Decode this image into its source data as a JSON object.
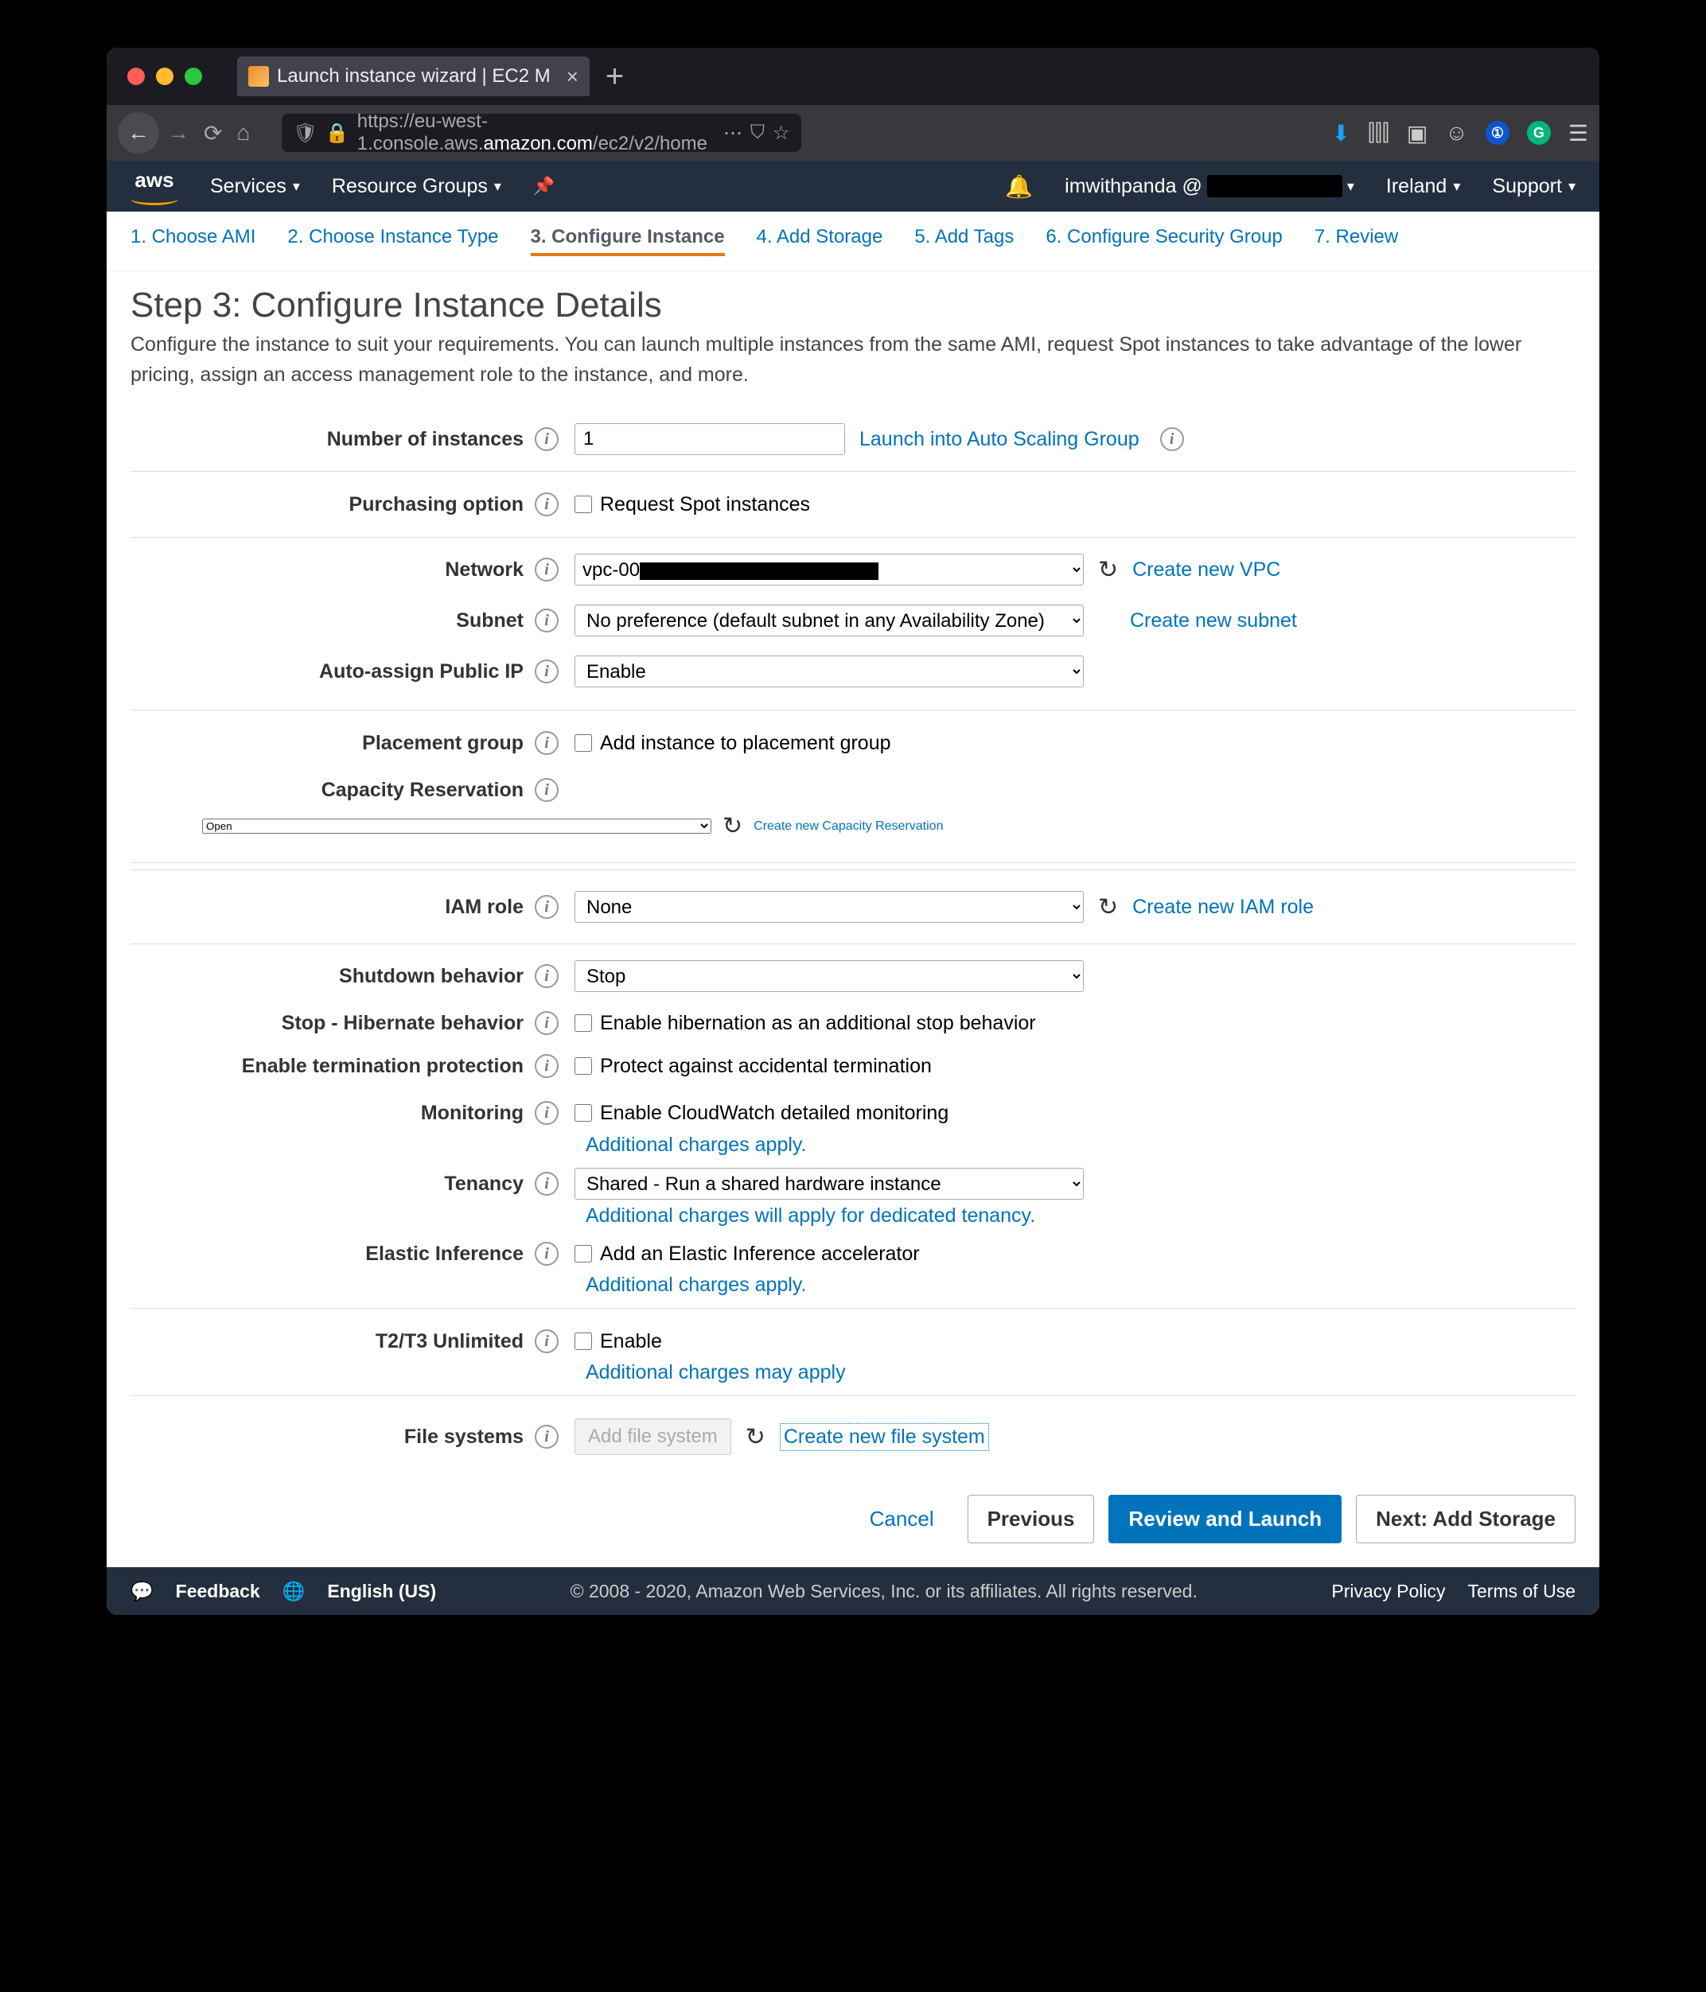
{
  "browser": {
    "tab_title": "Launch instance wizard | EC2 M",
    "url_prefix": "https://eu-west-1.console.aws.",
    "url_domain": "amazon.com",
    "url_path": "/ec2/v2/home"
  },
  "header": {
    "services": "Services",
    "resource_groups": "Resource Groups",
    "user": "imwithpanda @",
    "region": "Ireland",
    "support": "Support"
  },
  "steps": {
    "s1": "1. Choose AMI",
    "s2": "2. Choose Instance Type",
    "s3": "3. Configure Instance",
    "s4": "4. Add Storage",
    "s5": "5. Add Tags",
    "s6": "6. Configure Security Group",
    "s7": "7. Review"
  },
  "page": {
    "title": "Step 3: Configure Instance Details",
    "desc": "Configure the instance to suit your requirements. You can launch multiple instances from the same AMI, request Spot instances to take advantage of the lower pricing, assign an access management role to the instance, and more."
  },
  "form": {
    "num_instances_label": "Number of instances",
    "num_instances_value": "1",
    "launch_asg": "Launch into Auto Scaling Group",
    "purchasing_label": "Purchasing option",
    "purchasing_cb": "Request Spot instances",
    "network_label": "Network",
    "network_value": "vpc-00",
    "create_vpc": "Create new VPC",
    "subnet_label": "Subnet",
    "subnet_value": "No preference (default subnet in any Availability Zone)",
    "create_subnet": "Create new subnet",
    "public_ip_label": "Auto-assign Public IP",
    "public_ip_value": "Enable",
    "placement_label": "Placement group",
    "placement_cb": "Add instance to placement group",
    "capacity_label": "Capacity Reservation",
    "capacity_value": "Open",
    "create_capacity": "Create new Capacity Reservation",
    "iam_label": "IAM role",
    "iam_value": "None",
    "create_iam": "Create new IAM role",
    "shutdown_label": "Shutdown behavior",
    "shutdown_value": "Stop",
    "hibernate_label": "Stop - Hibernate behavior",
    "hibernate_cb": "Enable hibernation as an additional stop behavior",
    "termination_label": "Enable termination protection",
    "termination_cb": "Protect against accidental termination",
    "monitoring_label": "Monitoring",
    "monitoring_cb": "Enable CloudWatch detailed monitoring",
    "charges_apply": "Additional charges apply.",
    "charges_dedicated": "Additional charges will apply for dedicated tenancy.",
    "charges_may": "Additional charges may apply",
    "tenancy_label": "Tenancy",
    "tenancy_value": "Shared - Run a shared hardware instance",
    "elastic_label": "Elastic Inference",
    "elastic_cb": "Add an Elastic Inference accelerator",
    "t2t3_label": "T2/T3 Unlimited",
    "t2t3_cb": "Enable",
    "fs_label": "File systems",
    "add_fs": "Add file system",
    "create_fs": "Create new file system"
  },
  "buttons": {
    "cancel": "Cancel",
    "previous": "Previous",
    "review": "Review and Launch",
    "next": "Next: Add Storage"
  },
  "footer": {
    "feedback": "Feedback",
    "language": "English (US)",
    "copy": "© 2008 - 2020, Amazon Web Services, Inc. or its affiliates. All rights reserved.",
    "privacy": "Privacy Policy",
    "terms": "Terms of Use"
  }
}
